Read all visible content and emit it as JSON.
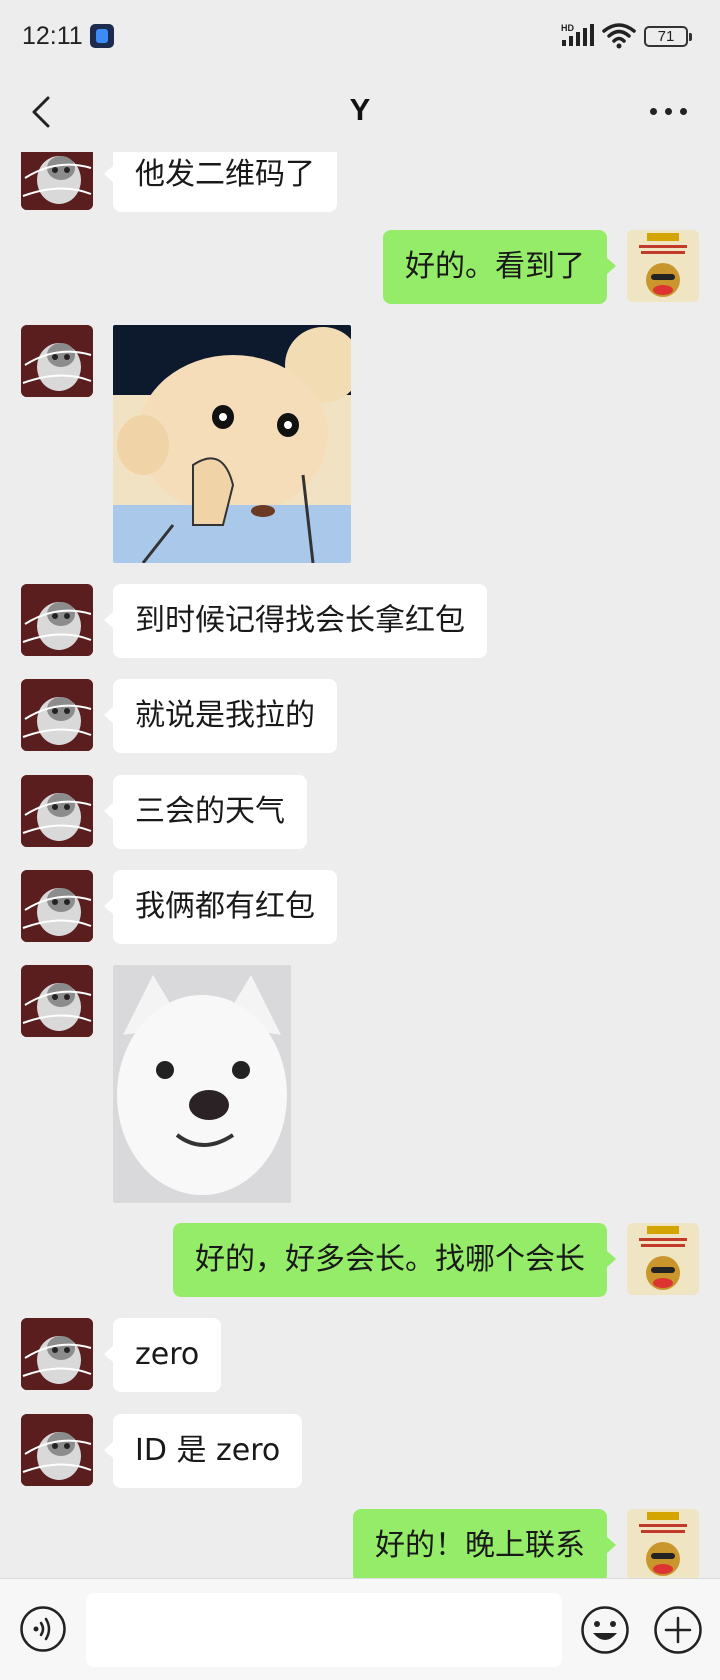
{
  "status_bar": {
    "time": "12:11",
    "network": "HD",
    "battery": "71"
  },
  "header": {
    "title": "Y"
  },
  "messages": [
    {
      "side": "left",
      "type": "text",
      "text": "他发二维码了"
    },
    {
      "side": "right",
      "type": "text",
      "text": "好的。看到了"
    },
    {
      "side": "left",
      "type": "image",
      "image": "cartoon-boy-sticker"
    },
    {
      "side": "left",
      "type": "text",
      "text": "到时候记得找会长拿红包"
    },
    {
      "side": "left",
      "type": "text",
      "text": "就说是我拉的"
    },
    {
      "side": "left",
      "type": "text",
      "text": "三会的天气"
    },
    {
      "side": "left",
      "type": "text",
      "text": "我俩都有红包"
    },
    {
      "side": "left",
      "type": "image",
      "image": "white-dog-sticker"
    },
    {
      "side": "right",
      "type": "text",
      "text": "好的，好多会长。找哪个会长"
    },
    {
      "side": "left",
      "type": "text",
      "text": "zero"
    },
    {
      "side": "left",
      "type": "text",
      "text": "ID 是 zero"
    },
    {
      "side": "right",
      "type": "text",
      "text": "好的！晚上联系"
    }
  ],
  "input": {
    "value": "",
    "placeholder": ""
  },
  "colors": {
    "background": "#ededed",
    "bubble_self": "#95ec69",
    "bubble_other": "#ffffff"
  },
  "icons": [
    "back-icon",
    "more-icon",
    "voice-icon",
    "emoji-icon",
    "plus-icon",
    "signal-icon",
    "wifi-icon",
    "battery-icon"
  ]
}
